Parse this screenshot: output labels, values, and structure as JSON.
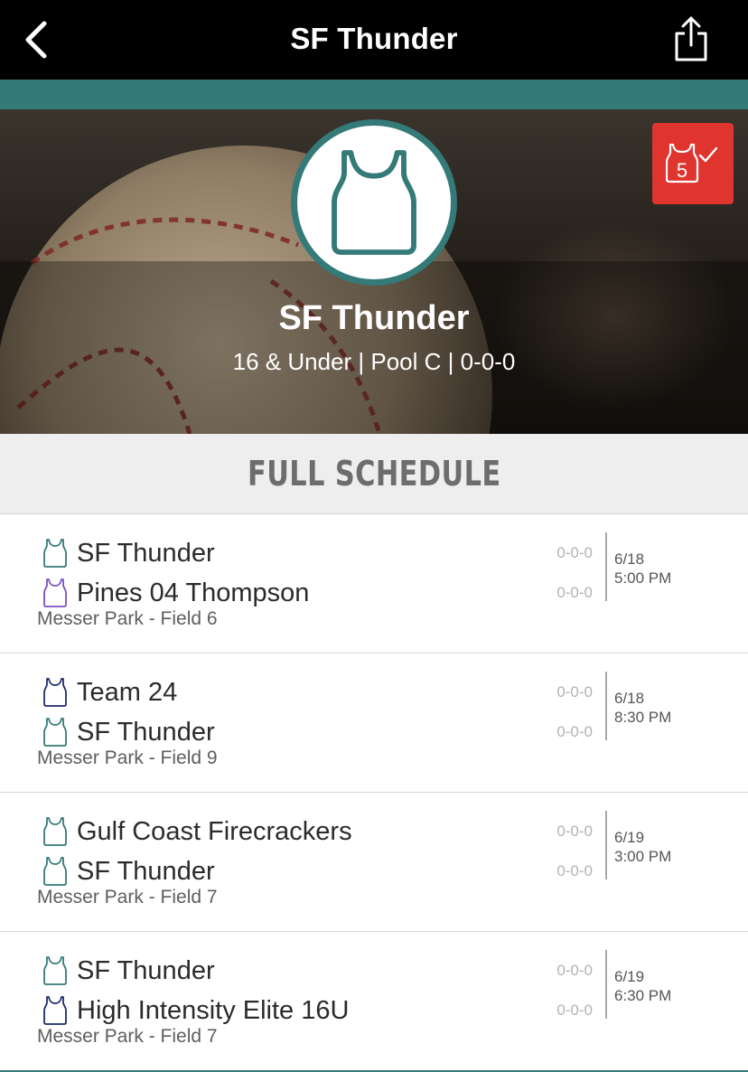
{
  "nav": {
    "title": "SF Thunder",
    "back_icon": "chevron-left-icon",
    "share_icon": "share-icon"
  },
  "team": {
    "name": "SF Thunder",
    "subtitle": "16 & Under | Pool C | 0-0-0",
    "logo_icon": "jersey-icon",
    "badge_number": "5",
    "badge_icon": "jersey-check-icon"
  },
  "schedule": {
    "heading": "FULL SCHEDULE",
    "games": [
      {
        "team1": {
          "name": "SF Thunder",
          "color": "#347a78"
        },
        "team2": {
          "name": "Pines 04 Thompson",
          "color": "#7b4fc4"
        },
        "score1": "0-0-0",
        "score2": "0-0-0",
        "location": "Messer Park - Field 6",
        "date": "6/18",
        "time": "5:00 PM"
      },
      {
        "team1": {
          "name": "Team 24",
          "color": "#1f2a6b"
        },
        "team2": {
          "name": "SF Thunder",
          "color": "#347a78"
        },
        "score1": "0-0-0",
        "score2": "0-0-0",
        "location": "Messer Park - Field 9",
        "date": "6/18",
        "time": "8:30 PM"
      },
      {
        "team1": {
          "name": "Gulf Coast Firecrackers",
          "color": "#347a78"
        },
        "team2": {
          "name": "SF Thunder",
          "color": "#347a78"
        },
        "score1": "0-0-0",
        "score2": "0-0-0",
        "location": "Messer Park - Field 7",
        "date": "6/19",
        "time": "3:00 PM"
      },
      {
        "team1": {
          "name": "SF Thunder",
          "color": "#347a78"
        },
        "team2": {
          "name": "High Intensity Elite 16U",
          "color": "#1f2a6b"
        },
        "score1": "0-0-0",
        "score2": "0-0-0",
        "location": "Messer Park - Field 7",
        "date": "6/19",
        "time": "6:30 PM"
      }
    ]
  },
  "colors": {
    "accent": "#347a78",
    "badge": "#e0342f",
    "topbar": "#000000"
  }
}
